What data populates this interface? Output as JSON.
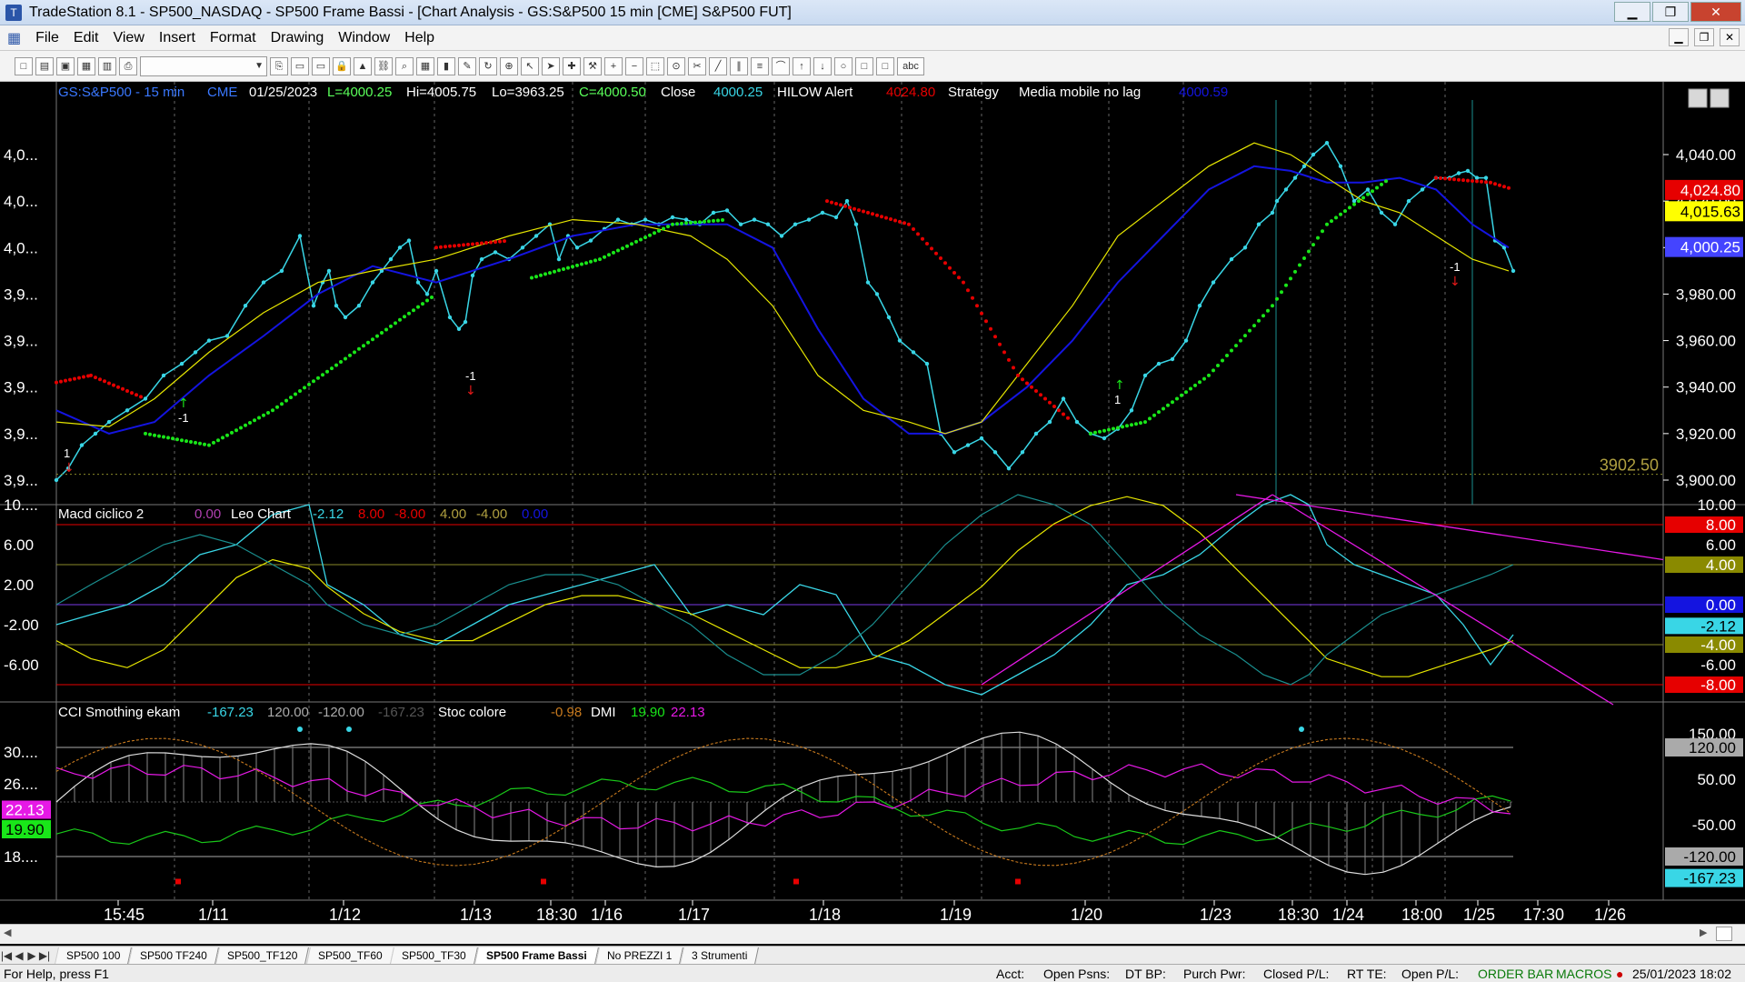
{
  "window": {
    "title": "TradeStation 8.1 - SP500_NASDAQ - SP500 Frame Bassi - [Chart Analysis - GS:S&P500  15 min  [CME] S&P500 FUT]",
    "buttons": [
      "▁",
      "❐",
      "✕"
    ]
  },
  "menu": {
    "items": [
      "File",
      "Edit",
      "View",
      "Insert",
      "Format",
      "Drawing",
      "Window",
      "Help"
    ],
    "mdi_buttons": [
      "▁",
      "❐",
      "✕"
    ]
  },
  "toolbar": {
    "symbol_value": "",
    "icons": [
      "new-icon",
      "open-icon",
      "save-icon",
      "saveall-icon",
      "folder-icon",
      "print-icon",
      "printpreview-icon",
      "window-icon",
      "window2-icon",
      "lock-icon",
      "chart-icon",
      "link-icon",
      "search-icon",
      "grid-icon",
      "bars-icon",
      "format-icon",
      "refresh-icon",
      "zoom-icon",
      "cursor-icon",
      "pointer-icon",
      "crosshair-icon",
      "hammer-icon",
      "zoom-in-icon",
      "zoom-out-icon",
      "select-icon",
      "track-icon",
      "tools-icon",
      "trendline-icon",
      "channel-icon",
      "fib-icon",
      "gann-icon",
      "arrow-up-icon",
      "arrow-down-icon",
      "circle-icon",
      "rect-icon",
      "text-icon"
    ],
    "text_tool": "abc"
  },
  "chart": {
    "header": {
      "symbol": "GS:S&P500 - 15 min",
      "exchange": "CME",
      "date": "01/25/2023",
      "low_lbl": "L=4000.25",
      "hi": "Hi=4005.75",
      "lo": "Lo=3963.25",
      "close_eq": "C=4000.50",
      "close_word": "Close",
      "close_val": "4000.25",
      "hilow": "HILOW Alert",
      "hilow_val": "4024.80",
      "strategy": "Strategy",
      "media": "Media mobile no lag",
      "media_val": "4000.59"
    },
    "price_axis_labels": [
      "4,040.00",
      "4,020.00",
      "4,000.00",
      "3,980.00",
      "3,960.00",
      "3,940.00",
      "3,920.00",
      "3,900.00"
    ],
    "left_axis_labels": [
      "4,0...",
      "4,0...",
      "4,0...",
      "3,9...",
      "3,9...",
      "3,9...",
      "3,9...",
      "3,9..."
    ],
    "price_badges": [
      "4,024.80",
      "4,015.63",
      "4,000.25"
    ],
    "reference_level": "3902.50",
    "signals": [
      "1",
      "-1",
      "-1",
      "1",
      "1",
      "-1"
    ],
    "macd": {
      "name": "Macd ciclico 2",
      "val": "0.00",
      "leo": "Leo Chart",
      "v1": "-2.12",
      "v2": "8.00",
      "v3": "-8.00",
      "v4": "4.00",
      "v5": "-4.00",
      "v6": "0.00",
      "left_labels": [
        "10....",
        "6.00",
        "2.00",
        "-2.00",
        "-6.00"
      ],
      "right_labels": [
        "10.00",
        "8.00",
        "6.00",
        "4.00",
        "0.00",
        "-2.12",
        "-4.00",
        "-6.00",
        "-8.00"
      ]
    },
    "cci": {
      "name": "CCI Smothing ekam",
      "v1": "-167.23",
      "v2": "120.00",
      "v3": "-120.00",
      "v4": "-167.23",
      "stoc": "Stoc colore",
      "stoc_val": "-0.98",
      "dmi": "DMI",
      "dmi1": "19.90",
      "dmi2": "22.13",
      "left_labels": [
        "30....",
        "26....",
        "18...."
      ],
      "left_badges": [
        "22.13",
        "19.90"
      ],
      "right_labels": [
        "150.00",
        "120.00",
        "50.00",
        "-50.00",
        "-120.00",
        "-167.23"
      ]
    },
    "time_axis": [
      "15:45",
      "1/11",
      "1/12",
      "1/13",
      "18:30",
      "1/16",
      "1/17",
      "1/18",
      "1/19",
      "1/20",
      "1/23",
      "18:30",
      "1/24",
      "18:00",
      "1/25",
      "17:30",
      "1/26"
    ],
    "colors": {
      "price": "#39d6e6",
      "avg_blue": "#1414e0",
      "avg_yellow": "#e6e600",
      "hilow_red": "#e60000",
      "hilow_green": "#19e619",
      "magenta": "#e619e6",
      "grey": "#b0b0b0",
      "orange": "#c87a1e"
    }
  },
  "tabs": [
    "SP500 100",
    "SP500 TF240",
    "SP500_TF120",
    "SP500_TF60",
    "SP500_TF30",
    "SP500 Frame Bassi",
    "No PREZZI 1",
    "3 Strumenti"
  ],
  "active_tab": "SP500 Frame Bassi",
  "status": {
    "help": "For Help, press F1",
    "acct": "Acct:",
    "open_psns": "Open Psns:",
    "dt_bp": "DT BP:",
    "purch_pwr": "Purch Pwr:",
    "closed_pl": "Closed P/L:",
    "rt_te": "RT TE:",
    "open_pl": "Open P/L:",
    "order_bar": "ORDER BAR",
    "macros": "MACROS",
    "datetime": "25/01/2023 18:02"
  }
}
